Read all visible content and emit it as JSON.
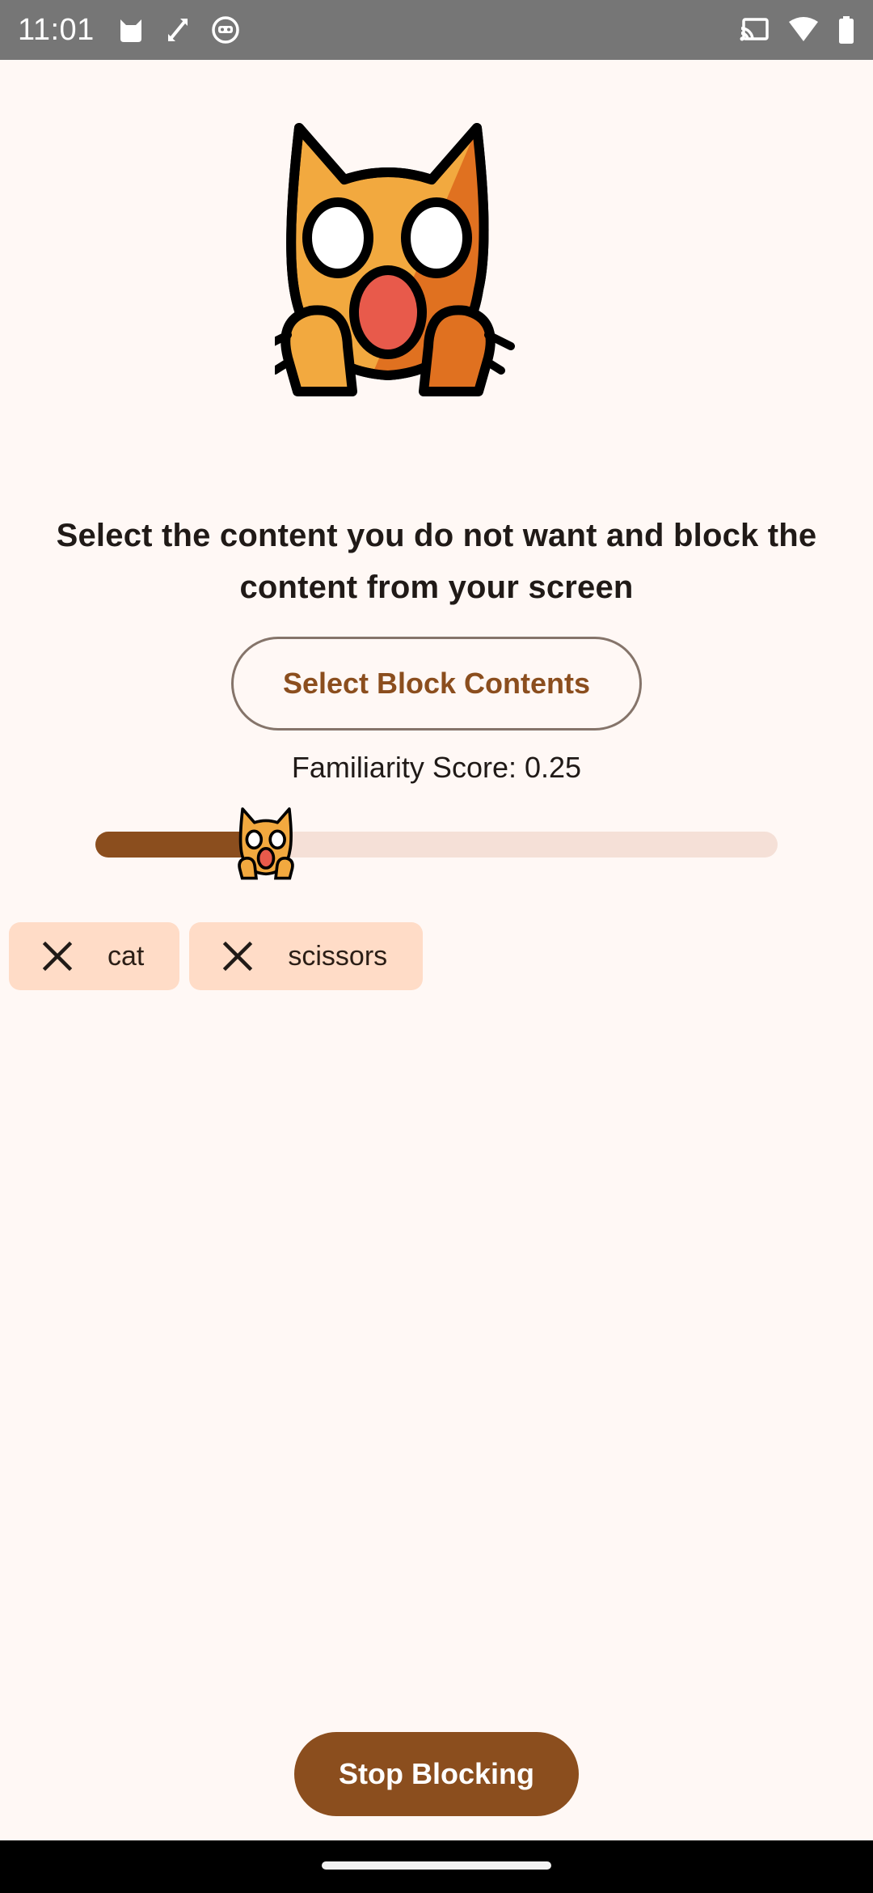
{
  "status_bar": {
    "time": "11:01",
    "left_icons": [
      "cat-silhouette-icon",
      "cursor-arrows-icon",
      "robot-face-icon"
    ],
    "right_icons": [
      "cast-icon",
      "wifi-icon",
      "battery-icon"
    ]
  },
  "hero": {
    "icon": "scared-cat-face-icon"
  },
  "description": "Select the content you do not want and block the content from your screen",
  "select_button": {
    "label": "Select Block Contents"
  },
  "familiarity": {
    "label": "Familiarity Score:",
    "value": "0.25",
    "slider_value": 0.25,
    "thumb_icon": "scared-cat-face-icon"
  },
  "chips": [
    {
      "label": "cat",
      "icon": "close-icon"
    },
    {
      "label": "scissors",
      "icon": "close-icon"
    }
  ],
  "stop_button": {
    "label": "Stop Blocking"
  },
  "colors": {
    "accent": "#8B4E1E",
    "background": "#FFF8F5",
    "chip_background": "#FFDCC7",
    "track": "#F5E0D7"
  }
}
